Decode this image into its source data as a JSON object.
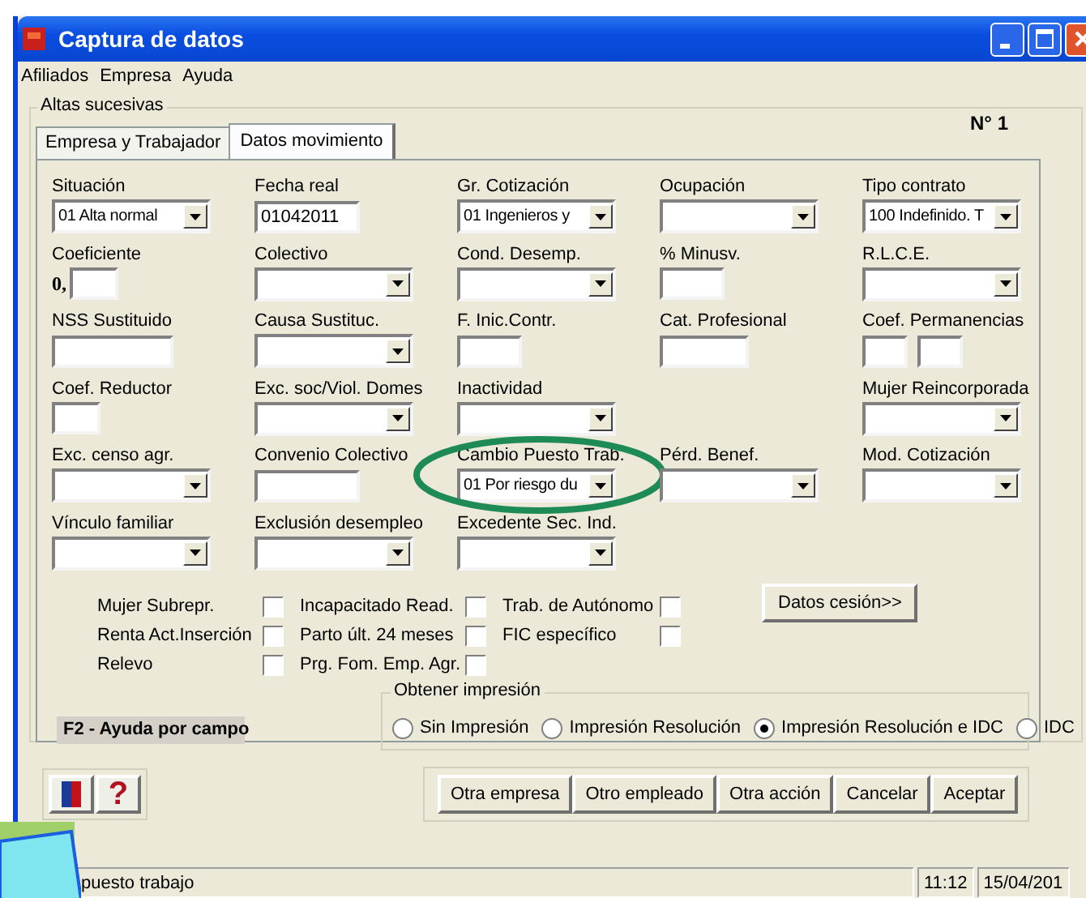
{
  "window": {
    "title": "Captura de datos"
  },
  "menu": [
    "Afiliados",
    "Empresa",
    "Ayuda"
  ],
  "group_title": "Altas sucesivas",
  "record_number": "N° 1",
  "tabs": [
    {
      "label": "Empresa y Trabajador",
      "selected": false
    },
    {
      "label": "Datos movimiento",
      "selected": true
    }
  ],
  "field_rows": [
    [
      {
        "label": "Situación",
        "kind": "combo",
        "value": "01 Alta normal",
        "highlighted": false
      },
      {
        "label": "Fecha real",
        "kind": "text",
        "value": "01042011",
        "highlighted": false
      },
      {
        "label": "Gr. Cotización",
        "kind": "combo",
        "value": "01 Ingenieros y",
        "highlighted": false
      },
      {
        "label": "Ocupación",
        "kind": "combo",
        "highlighted": false
      },
      {
        "label": "Tipo contrato",
        "kind": "combo",
        "value": "100 Indefinido. T",
        "highlighted": false
      }
    ],
    [
      {
        "label": "Coeficiente",
        "kind": "decimal",
        "prefix": "0,",
        "highlighted": false
      },
      {
        "label": "Colectivo",
        "kind": "combo",
        "highlighted": false
      },
      {
        "label": "Cond. Desemp.",
        "kind": "combo",
        "highlighted": false
      },
      {
        "label": "% Minusv.",
        "kind": "short",
        "highlighted": false
      },
      {
        "label": "R.L.C.E.",
        "kind": "combo",
        "highlighted": false
      }
    ],
    [
      {
        "label": "NSS Sustituido",
        "kind": "long",
        "highlighted": false
      },
      {
        "label": "Causa Sustituc.",
        "kind": "combo",
        "highlighted": false
      },
      {
        "label": "F. Inic.Contr.",
        "kind": "short",
        "highlighted": false
      },
      {
        "label": "Cat. Profesional",
        "kind": "medium",
        "highlighted": false
      },
      {
        "label": "Coef. Permanencias",
        "kind": "pair",
        "highlighted": false
      }
    ],
    [
      {
        "label": "Coef. Reductor",
        "kind": "tiny",
        "highlighted": false
      },
      {
        "label": "Exc. soc/Viol. Domes",
        "kind": "combo",
        "highlighted": false
      },
      {
        "label": "Inactividad",
        "kind": "combo",
        "highlighted": false
      },
      {
        "label": "Mujer Reincorporada",
        "kind": "combo_last",
        "highlighted": false
      }
    ],
    [
      {
        "label": "Exc. censo agr.",
        "kind": "combo",
        "highlighted": false
      },
      {
        "label": "Convenio Colectivo",
        "kind": "text",
        "highlighted": false
      },
      {
        "label": "Cambio Puesto Trab.",
        "kind": "combo",
        "value": "01 Por riesgo du",
        "highlighted": true
      },
      {
        "label": "Pérd. Benef.",
        "kind": "combo",
        "highlighted": false
      },
      {
        "label": "Mod. Cotización",
        "kind": "combo",
        "highlighted": false
      }
    ],
    [
      {
        "label": "Vínculo familiar",
        "kind": "combo",
        "highlighted": false
      },
      {
        "label": "Exclusión desempleo",
        "kind": "combo",
        "highlighted": false
      },
      {
        "label": "Excedente Sec. Ind.",
        "kind": "combo",
        "highlighted": false
      }
    ]
  ],
  "checkbox_columns": [
    [
      {
        "label": "Mujer Subrepr.",
        "checked": false
      },
      {
        "label": "Renta Act.Inserción",
        "checked": false
      },
      {
        "label": "Relevo",
        "checked": false
      }
    ],
    [
      {
        "label": "Incapacitado Read.",
        "checked": false
      },
      {
        "label": "Parto últ. 24 meses",
        "checked": false
      },
      {
        "label": "Prg. Fom. Emp. Agr.",
        "checked": false
      }
    ],
    [
      {
        "label": "Trab. de Autónomo",
        "checked": false
      },
      {
        "label": "FIC específico",
        "checked": false
      }
    ]
  ],
  "cession_button": "Datos cesión>>",
  "help_hint": "F2 - Ayuda por campo",
  "print_group": {
    "title": "Obtener impresión",
    "options": [
      {
        "label": "Sin Impresión",
        "selected": false
      },
      {
        "label": "Impresión Resolución",
        "selected": false
      },
      {
        "label": "Impresión Resolución e IDC",
        "selected": true
      },
      {
        "label": "IDC",
        "selected": false
      }
    ]
  },
  "help_button": "?",
  "buttons": [
    "Otra empresa",
    "Otro empleado",
    "Otra acción",
    "Cancelar",
    "Aceptar"
  ],
  "status_bar": {
    "message": "puesto trabajo",
    "time": "11:12",
    "date": "15/04/201"
  }
}
